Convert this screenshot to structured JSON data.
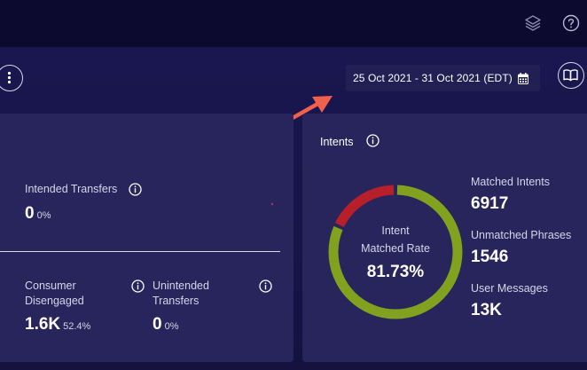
{
  "date_range": {
    "label": "25 Oct 2021 - 31 Oct 2021 (EDT)"
  },
  "left_card": {
    "intended_transfers": {
      "label": "Intended Transfers",
      "value": "0",
      "pct": "0%"
    },
    "consumer_disengaged": {
      "label_line1": "Consumer",
      "label_line2": "Disengaged",
      "value": "1.6K",
      "pct": "52.4%"
    },
    "unintended_transfers": {
      "label_line1": "Unintended",
      "label_line2": "Transfers",
      "value": "0",
      "pct": "0%"
    }
  },
  "intents": {
    "title": "Intents",
    "ring": {
      "line1": "Intent",
      "line2": "Matched Rate",
      "value": "81.73%",
      "matched_fraction": 0.8173
    },
    "stats": [
      {
        "label": "Matched Intents",
        "value": "6917"
      },
      {
        "label": "Unmatched Phrases",
        "value": "1546"
      },
      {
        "label": "User Messages",
        "value": "13K"
      }
    ]
  },
  "colors": {
    "matched": "#82a21f",
    "unmatched": "#b7202a",
    "arrow": "#f0604d",
    "card": "#27255c"
  },
  "icons": [
    "layers-icon",
    "help-icon",
    "more-vertical-icon",
    "calendar-icon",
    "book-icon",
    "info-icon"
  ]
}
